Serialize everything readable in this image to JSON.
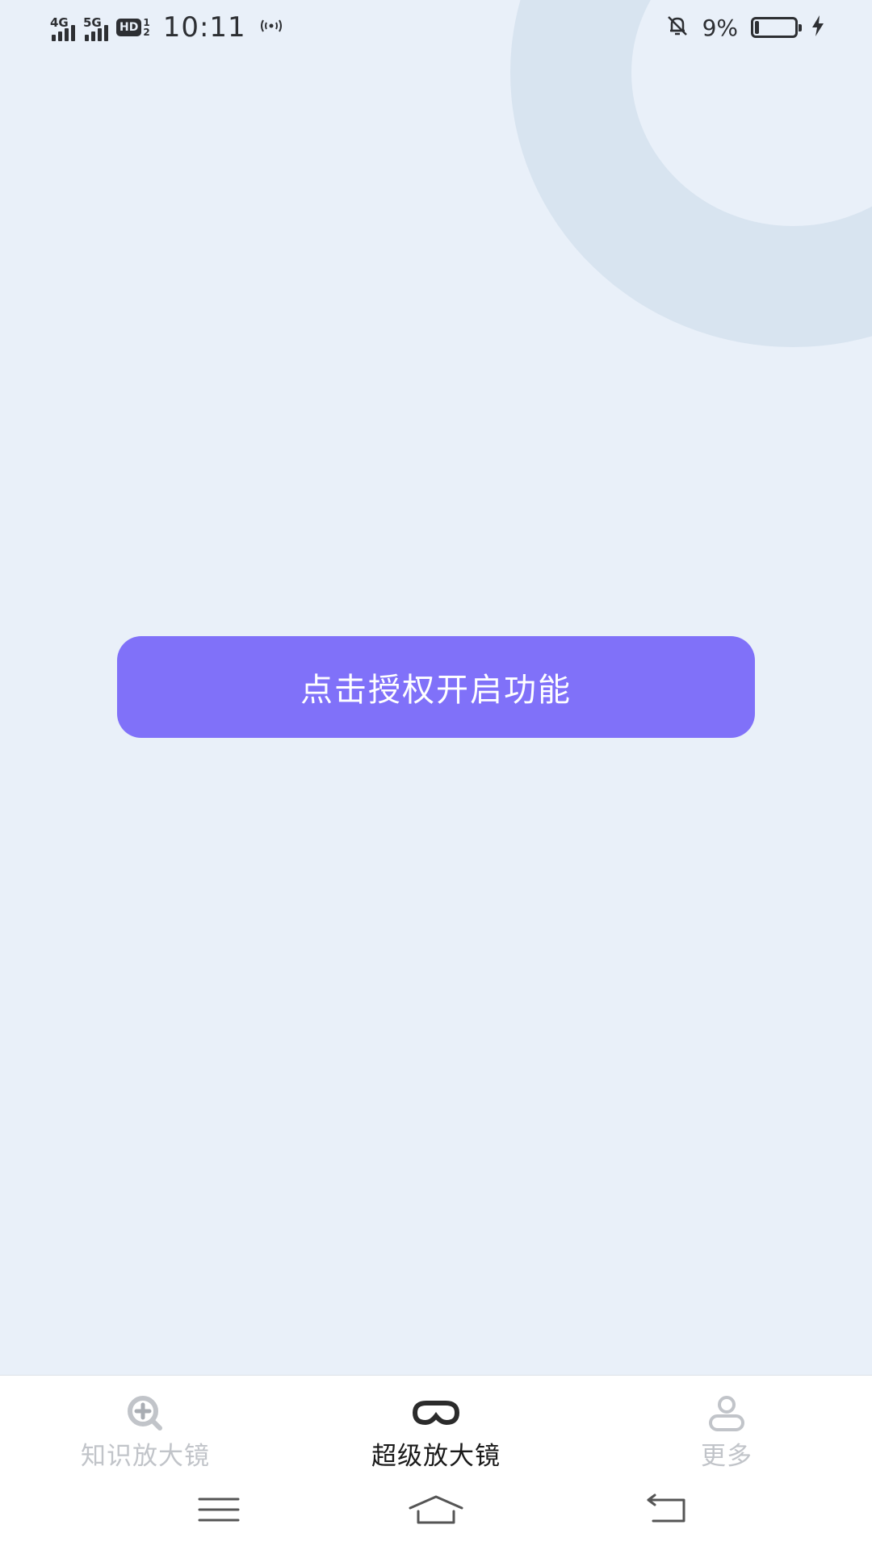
{
  "status_bar": {
    "signal1_label": "4G",
    "signal2_label": "5G",
    "hd_label": "HD",
    "hd_sub_top": "1",
    "hd_sub_bottom": "2",
    "time": "10:11",
    "battery_percent": "9%",
    "battery_level": 0.09,
    "icons": [
      "signal-icon",
      "hd-voice-icon",
      "wifi-calling-icon",
      "mute-bell-icon",
      "battery-icon",
      "charging-icon"
    ]
  },
  "main": {
    "authorize_button_label": "点击授权开启功能"
  },
  "tabbar": {
    "tabs": [
      {
        "label": "知识放大镜",
        "icon": "magnifier-plus-icon",
        "active": false
      },
      {
        "label": "超级放大镜",
        "icon": "glasses-icon",
        "active": true
      },
      {
        "label": "更多",
        "icon": "user-icon",
        "active": false
      }
    ]
  },
  "navbar": {
    "buttons": [
      "menu-icon",
      "home-icon",
      "back-icon"
    ]
  },
  "colors": {
    "background": "#e9f0f9",
    "accent": "#8071f9",
    "tab_inactive": "#c1c4c9",
    "tab_active": "#1a1a1a"
  }
}
